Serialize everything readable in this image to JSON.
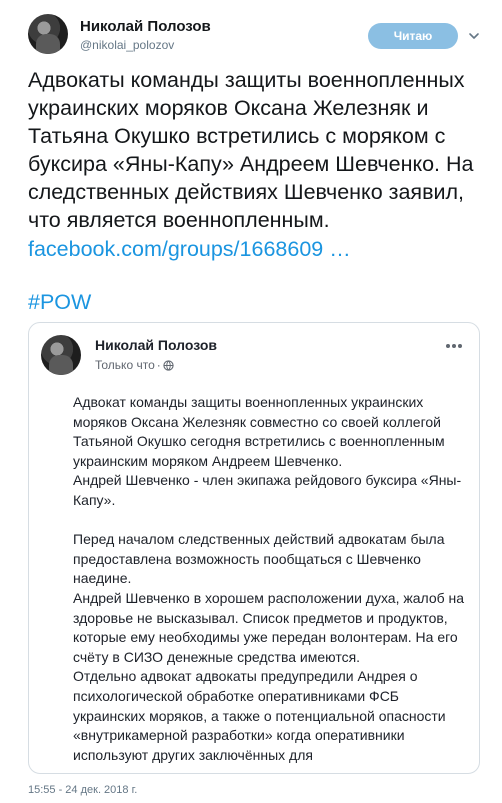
{
  "tweet": {
    "author_name": "Николай Полозов",
    "handle": "@nikolai_polozov",
    "follow_label": "Читаю",
    "text": "Адвокаты команды защиты военнопленных украинских моряков Оксана Железняк и Татьяна Окушко встретились с моряком с буксира «Яны-Капу» Андреем Шевченко. На следственных действиях Шевченко заявил, что является военнопленным.",
    "link_text": "facebook.com/groups/1668609  …",
    "hashtag": "#POW",
    "timestamp": "15:55 - 24 дек. 2018 г."
  },
  "embedded_post": {
    "author_name": "Николай Полозов",
    "time_label": "Только что",
    "dot": "·",
    "paragraphs": [
      "Адвокат команды защиты военнопленных украинских моряков Оксана Железняк совместно со своей коллегой Татьяной Окушко сегодня встретились с военнопленным украинским моряком Андреем Шевченко.",
      "Андрей Шевченко - член экипажа рейдового буксира «Яны-Капу».",
      "Перед началом следственных действий адвокатам была предоставлена возможность пообщаться с Шевченко наедине.",
      "Андрей Шевченко в хорошем расположении духа, жалоб на здоровье не высказывал. Список предметов и продуктов, которые ему необходимы уже передан волонтерам. На его счёту в СИЗО денежные средства имеются.",
      "Отдельно адвокат адвокаты предупредили Андрея о психологической обработке оперативниками ФСБ украинских моряков, а также о потенциальной опасности «внутрикамерной разработки» когда оперативники используют других заключённых для"
    ]
  },
  "icons": {
    "caret": "chevron-down-icon",
    "globe": "globe-icon",
    "more": "more-horizontal-icon"
  },
  "colors": {
    "link": "#1b95e0",
    "follow_button": "#8bbfe3",
    "muted_text": "#657786"
  }
}
